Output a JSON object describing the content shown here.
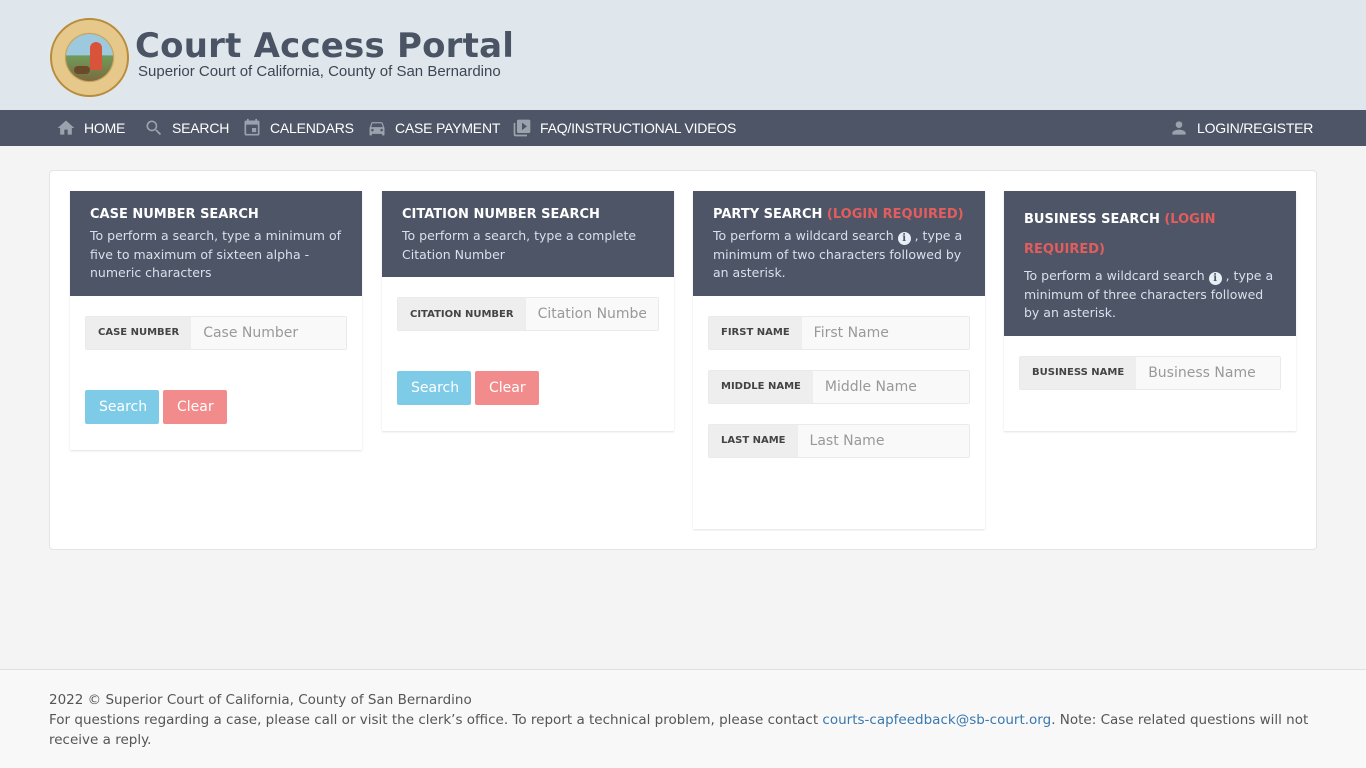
{
  "header": {
    "title": "Court Access Portal",
    "subtitle": "Superior Court of California, County of San Bernardino",
    "seal_alt": "Superior Court of California County of San Bernardino seal"
  },
  "nav": {
    "items": [
      {
        "label": "HOME",
        "icon": "home-icon"
      },
      {
        "label": "SEARCH",
        "icon": "search-icon"
      },
      {
        "label": "CALENDARS",
        "icon": "calendar-icon"
      },
      {
        "label": "CASE PAYMENT",
        "icon": "car-icon"
      },
      {
        "label": "FAQ/INSTRUCTIONAL VIDEOS",
        "icon": "video-library-icon"
      }
    ],
    "login": {
      "label": "LOGIN/REGISTER",
      "icon": "user-icon"
    }
  },
  "cards": {
    "case": {
      "title": "CASE NUMBER SEARCH",
      "description": "To perform a search, type a minimum of five to maximum of sixteen alpha - numeric characters",
      "fields": [
        {
          "label": "CASE NUMBER",
          "placeholder": "Case Number",
          "value": ""
        }
      ],
      "search_label": "Search",
      "clear_label": "Clear"
    },
    "citation": {
      "title": "CITATION NUMBER SEARCH",
      "description": "To perform a search, type a complete Citation Number",
      "fields": [
        {
          "label": "CITATION NUMBER",
          "placeholder": "Citation Number",
          "value": ""
        }
      ],
      "search_label": "Search",
      "clear_label": "Clear"
    },
    "party": {
      "title": "PARTY SEARCH",
      "required": "(LOGIN REQUIRED)",
      "description_before": "To perform a wildcard search",
      "description_after": ", type a minimum of two characters followed by an asterisk.",
      "fields": [
        {
          "label": "FIRST NAME",
          "placeholder": "First Name",
          "value": ""
        },
        {
          "label": "MIDDLE NAME",
          "placeholder": "Middle Name",
          "value": ""
        },
        {
          "label": "LAST NAME",
          "placeholder": "Last Name",
          "value": ""
        }
      ]
    },
    "business": {
      "title": "BUSINESS SEARCH",
      "required": "(LOGIN REQUIRED)",
      "description_before": "To perform a wildcard search",
      "description_after": ", type a minimum of three characters followed by an asterisk.",
      "fields": [
        {
          "label": "BUSINESS NAME",
          "placeholder": "Business Name",
          "value": ""
        }
      ]
    }
  },
  "info_icon_glyph": "i",
  "footer": {
    "copyright": "2022 © Superior Court of California, County of San Bernardino",
    "contact_before": "For questions regarding a case, please call or visit the clerk’s office. To report a technical problem, please contact ",
    "contact_email": "courts-capfeedback@sb-court.org",
    "contact_after": ". Note: Case related questions will not receive a reply."
  },
  "colors": {
    "nav_bg": "#4d5566",
    "header_bg": "#dfe7ec",
    "required": "#e35d5d",
    "search_button": "#7ecbe8",
    "clear_button": "#f28b8b",
    "link": "#3a78b0"
  }
}
